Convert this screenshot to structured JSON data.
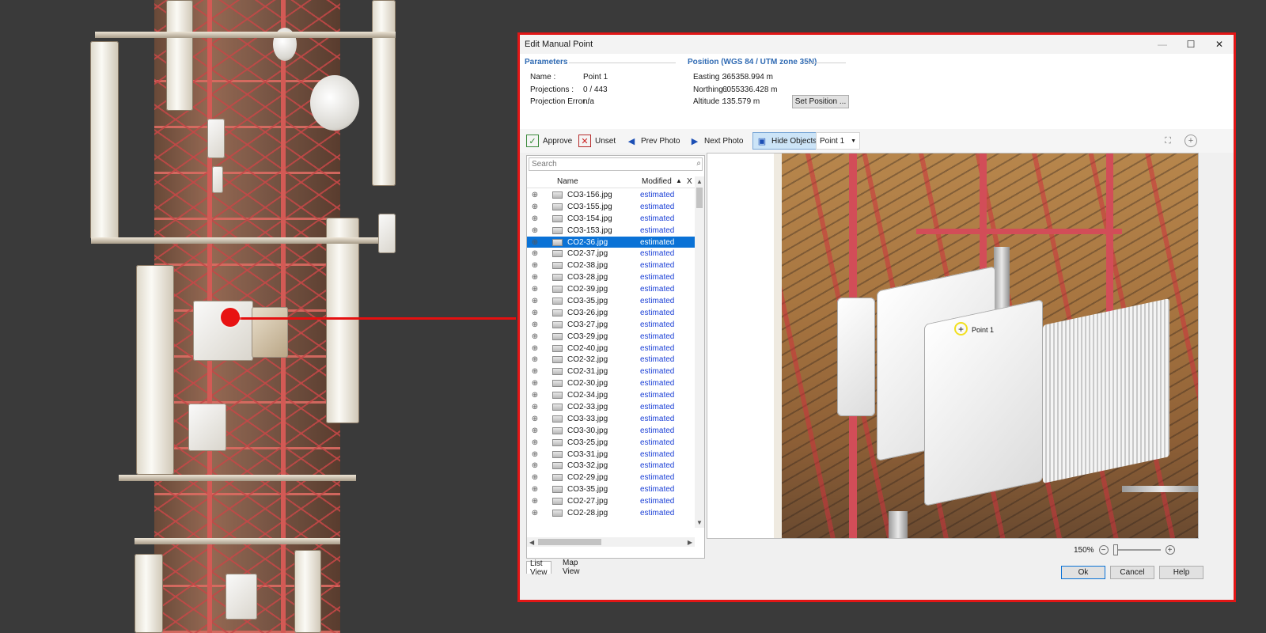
{
  "dialog": {
    "title": "Edit Manual Point",
    "window_controls": {
      "minimize": "—",
      "maximize": "☐",
      "close": "✕"
    }
  },
  "parameters": {
    "heading": "Parameters",
    "name_label": "Name :",
    "name_value": "Point 1",
    "projections_label": "Projections :",
    "projections_value": "0 / 443",
    "projection_error_label": "Projection Error :",
    "projection_error_value": "n/a"
  },
  "position": {
    "heading": "Position (WGS 84 / UTM zone 35N)",
    "easting_label": "Easting :",
    "easting_value": "365358.994 m",
    "northing_label": "Northing :",
    "northing_value": "6055336.428 m",
    "altitude_label": "Altitude :",
    "altitude_value": "135.579 m",
    "set_position_button": "Set Position ..."
  },
  "toolbar": {
    "approve": "Approve",
    "unset": "Unset",
    "prev_photo": "Prev Photo",
    "next_photo": "Next Photo",
    "hide_objects": "Hide Objects",
    "point_select": "Point 1"
  },
  "list": {
    "search_placeholder": "Search",
    "col_name": "Name",
    "col_modified": "Modified",
    "col_extra": "X",
    "rows": [
      {
        "name": "CO3-156.jpg",
        "status": "estimated"
      },
      {
        "name": "CO3-155.jpg",
        "status": "estimated"
      },
      {
        "name": "CO3-154.jpg",
        "status": "estimated"
      },
      {
        "name": "CO3-153.jpg",
        "status": "estimated"
      },
      {
        "name": "CO2-36.jpg",
        "status": "estimated"
      },
      {
        "name": "CO2-37.jpg",
        "status": "estimated"
      },
      {
        "name": "CO2-38.jpg",
        "status": "estimated"
      },
      {
        "name": "CO3-28.jpg",
        "status": "estimated"
      },
      {
        "name": "CO2-39.jpg",
        "status": "estimated"
      },
      {
        "name": "CO3-35.jpg",
        "status": "estimated"
      },
      {
        "name": "CO3-26.jpg",
        "status": "estimated"
      },
      {
        "name": "CO3-27.jpg",
        "status": "estimated"
      },
      {
        "name": "CO3-29.jpg",
        "status": "estimated"
      },
      {
        "name": "CO2-40.jpg",
        "status": "estimated"
      },
      {
        "name": "CO2-32.jpg",
        "status": "estimated"
      },
      {
        "name": "CO2-31.jpg",
        "status": "estimated"
      },
      {
        "name": "CO2-30.jpg",
        "status": "estimated"
      },
      {
        "name": "CO2-34.jpg",
        "status": "estimated"
      },
      {
        "name": "CO2-33.jpg",
        "status": "estimated"
      },
      {
        "name": "CO3-33.jpg",
        "status": "estimated"
      },
      {
        "name": "CO3-30.jpg",
        "status": "estimated"
      },
      {
        "name": "CO3-25.jpg",
        "status": "estimated"
      },
      {
        "name": "CO3-31.jpg",
        "status": "estimated"
      },
      {
        "name": "CO3-32.jpg",
        "status": "estimated"
      },
      {
        "name": "CO2-29.jpg",
        "status": "estimated"
      },
      {
        "name": "CO3-35.jpg",
        "status": "estimated"
      },
      {
        "name": "CO2-27.jpg",
        "status": "estimated"
      },
      {
        "name": "CO2-28.jpg",
        "status": "estimated"
      }
    ],
    "selected_index": 4,
    "tab_list": "List View",
    "tab_map": "Map View"
  },
  "viewer": {
    "point_label": "Point 1",
    "zoom_level": "150%"
  },
  "footer": {
    "ok": "Ok",
    "cancel": "Cancel",
    "help": "Help"
  },
  "colors": {
    "highlight_red": "#e11616",
    "selection_blue": "#0a72d6",
    "heading_blue": "#2f6ab3",
    "status_blue": "#1a3fd6",
    "target_yellow": "#f2e020"
  }
}
